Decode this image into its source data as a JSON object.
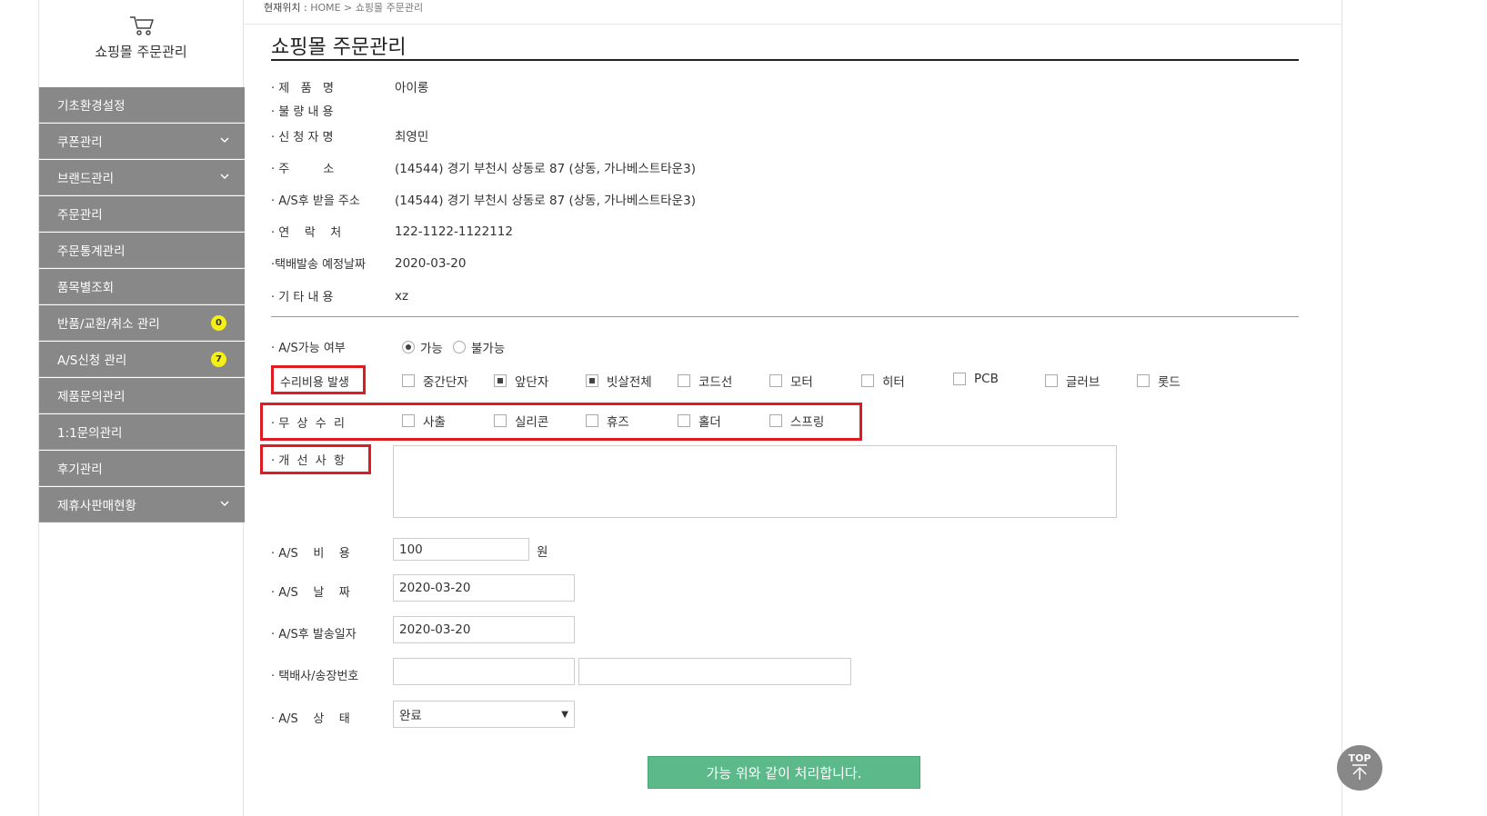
{
  "sidebar": {
    "title": "쇼핑몰 주문관리",
    "items": [
      {
        "label": "기초환경설정"
      },
      {
        "label": "쿠폰관리"
      },
      {
        "label": "브랜드관리"
      },
      {
        "label": "주문관리"
      },
      {
        "label": "주문통계관리"
      },
      {
        "label": "품목별조회"
      },
      {
        "label": "반품/교환/취소 관리",
        "badge": "0"
      },
      {
        "label": "A/S신청 관리",
        "badge": "7"
      },
      {
        "label": "제품문의관리"
      },
      {
        "label": "1:1문의관리"
      },
      {
        "label": "후기관리"
      },
      {
        "label": "제휴사판매현황"
      }
    ]
  },
  "breadcrumb": {
    "prefix": "현재위치 :",
    "path": "HOME > 쇼핑몰 주문관리"
  },
  "page_title": "쇼핑몰 주문관리",
  "info": [
    {
      "label": "· 제   품   명",
      "value": "아이롱"
    },
    {
      "label": "· 불 량 내 용",
      "value": ""
    },
    {
      "label": "· 신 청 자 명",
      "value": "최영민"
    },
    {
      "label": "· 주         소",
      "value": "(14544) 경기 부천시 상동로 87 (상동, 가나베스트타운3)"
    },
    {
      "label": "· A/S후 받을 주소",
      "value": "(14544) 경기 부천시 상동로 87 (상동, 가나베스트타운3)"
    },
    {
      "label": "· 연    락    처",
      "value": "122-1122-1122112"
    },
    {
      "label": "·택배발송 예정날짜",
      "value": "2020-03-20"
    },
    {
      "label": "· 기 타 내 용",
      "value": "xz"
    }
  ],
  "form": {
    "as_possible": {
      "label": "· A/S가능 여부",
      "options": [
        "가능",
        "불가능"
      ],
      "selected": "가능"
    },
    "repair_cost": {
      "label": "수리비용 발생",
      "options": [
        "중간단자",
        "앞단자",
        "빗살전체",
        "코드선",
        "모터",
        "히터",
        "PCB",
        "글러브",
        "롯드"
      ],
      "checked": [
        "앞단자",
        "빗살전체"
      ]
    },
    "free_repair": {
      "label": "· 무  상  수  리",
      "options": [
        "사출",
        "실리콘",
        "휴즈",
        "홀더",
        "스프링"
      ]
    },
    "improvement": {
      "label": "· 개  선  사  항",
      "value": ""
    },
    "as_cost": {
      "label": "· A/S    비    용",
      "value": "100",
      "unit": "원"
    },
    "as_date": {
      "label": "· A/S    날    짜",
      "value": "2020-03-20"
    },
    "ship_date": {
      "label": "· A/S후 발송일자",
      "value": "2020-03-20"
    },
    "courier": {
      "label": "· 택배사/송장번호",
      "company": "",
      "tracking": ""
    },
    "as_status": {
      "label": "· A/S    상    태",
      "value": "완료"
    }
  },
  "submit_label": "가능 위와 같이 처리합니다.",
  "top_button": "TOP",
  "colors": {
    "menu_bg": "#888888",
    "badge": "#f3ef17",
    "submit": "#5cb98a",
    "highlight": "#e11b22"
  }
}
